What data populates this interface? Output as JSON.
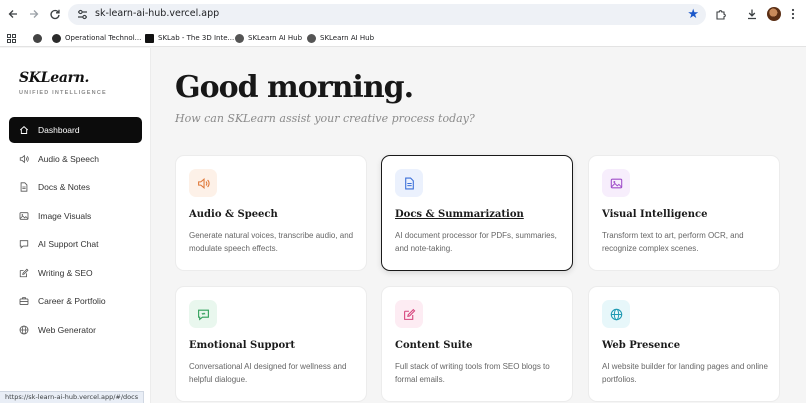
{
  "browser": {
    "url": "sk-learn-ai-hub.vercel.app",
    "bookmarks": [
      {
        "label": "Operational Technol...",
        "icon": "gear-bookmark-icon"
      },
      {
        "label": "SKLab - The 3D Inte...",
        "icon": "sklab-bookmark-icon"
      },
      {
        "label": "SKLearn AI Hub",
        "icon": "sklearn-bookmark-icon"
      },
      {
        "label": "SKLearn AI Hub",
        "icon": "sklearn-bookmark-icon"
      }
    ],
    "status_url": "https://sk-learn-ai-hub.vercel.app/#/docs"
  },
  "brand": {
    "name": "SKLearn.",
    "tagline": "UNIFIED INTELLIGENCE"
  },
  "sidebar": {
    "items": [
      {
        "label": "Dashboard",
        "icon": "home-icon",
        "active": true
      },
      {
        "label": "Audio & Speech",
        "icon": "speaker-icon"
      },
      {
        "label": "Docs & Notes",
        "icon": "document-icon"
      },
      {
        "label": "Image Visuals",
        "icon": "image-icon"
      },
      {
        "label": "AI Support Chat",
        "icon": "chat-icon"
      },
      {
        "label": "Writing & SEO",
        "icon": "pen-icon"
      },
      {
        "label": "Career & Portfolio",
        "icon": "briefcase-icon"
      },
      {
        "label": "Web Generator",
        "icon": "globe-icon"
      }
    ]
  },
  "main": {
    "greeting": "Good morning.",
    "subtitle": "How can SKLearn assist your creative process today?",
    "cards": [
      {
        "title": "Audio & Speech",
        "description": "Generate natural voices, transcribe audio, and modulate speech effects.",
        "icon": "speaker-icon",
        "accent": "#e0793a",
        "tint": "#fdf1e8"
      },
      {
        "title": "Docs & Summarization",
        "description": "AI document processor for PDFs, summaries, and note-taking.",
        "icon": "document-icon",
        "accent": "#3b6fd8",
        "tint": "#ebf1fd"
      },
      {
        "title": "Visual Intelligence",
        "description": "Transform text to art, perform OCR, and recognize complex scenes.",
        "icon": "image-icon",
        "accent": "#a04fc9",
        "tint": "#f7eefc"
      },
      {
        "title": "Emotional Support",
        "description": "Conversational AI designed for wellness and helpful dialogue.",
        "icon": "chat-icon",
        "accent": "#2e9f58",
        "tint": "#e9f7ee"
      },
      {
        "title": "Content Suite",
        "description": "Full stack of writing tools from SEO blogs to formal emails.",
        "icon": "pen-icon",
        "accent": "#d6457d",
        "tint": "#fdecf3"
      },
      {
        "title": "Web Presence",
        "description": "AI website builder for landing pages and online portfolios.",
        "icon": "globe-icon",
        "accent": "#1f9ab3",
        "tint": "#e7f7fa"
      }
    ]
  }
}
